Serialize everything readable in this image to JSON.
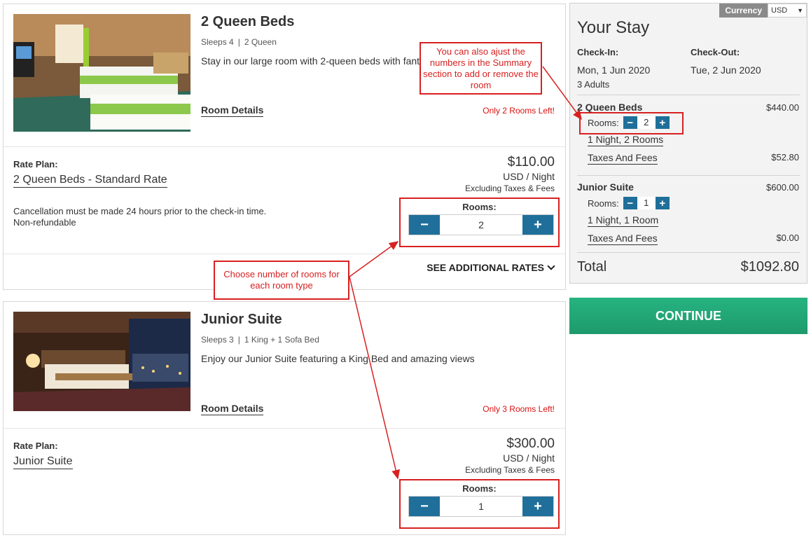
{
  "rooms": [
    {
      "title": "2 Queen Beds",
      "sleeps": "Sleeps 4",
      "beds": "2 Queen",
      "description": "Stay in our large room with 2-queen beds with fant",
      "details_link": "Room Details",
      "availability": "Only 2 Rooms Left!",
      "rate_label": "Rate Plan:",
      "rate_name": "2 Queen Beds - Standard Rate",
      "price": "$110.00",
      "price_unit": "USD / Night",
      "price_note": "Excluding Taxes & Fees",
      "cancellation_1": "Cancellation must be made 24 hours prior to the check-in time.",
      "cancellation_2": "Non-refundable",
      "rooms_label": "Rooms:",
      "rooms_count": "2",
      "see_more": "SEE ADDITIONAL RATES"
    },
    {
      "title": "Junior Suite",
      "sleeps": "Sleeps 3",
      "beds": "1 King + 1 Sofa Bed",
      "description": "Enjoy our Junior Suite featuring a King Bed and amazing views",
      "details_link": "Room Details",
      "availability": "Only 3 Rooms Left!",
      "rate_label": "Rate Plan:",
      "rate_name": "Junior Suite",
      "price": "$300.00",
      "price_unit": "USD / Night",
      "price_note": "Excluding Taxes & Fees",
      "rooms_label": "Rooms:",
      "rooms_count": "1"
    }
  ],
  "summary": {
    "currency_label": "Currency",
    "currency_value": "USD",
    "title": "Your Stay",
    "checkin_label": "Check-In:",
    "checkout_label": "Check-Out:",
    "checkin_date": "Mon, 1 Jun 2020",
    "checkout_date": "Tue, 2 Jun 2020",
    "guests": "3 Adults",
    "items": [
      {
        "name": "2 Queen Beds",
        "amount": "$440.00",
        "rooms_label": "Rooms:",
        "rooms_count": "2",
        "nights_link": "1 Night, 2 Rooms",
        "taxes_label": "Taxes And Fees",
        "taxes_amount": "$52.80"
      },
      {
        "name": "Junior Suite",
        "amount": "$600.00",
        "rooms_label": "Rooms:",
        "rooms_count": "1",
        "nights_link": "1 Night, 1 Room",
        "taxes_label": "Taxes And Fees",
        "taxes_amount": "$0.00"
      }
    ],
    "total_label": "Total",
    "total_value": "$1092.80"
  },
  "continue_label": "CONTINUE",
  "annotations": {
    "summary_note": "You can also ajust the numbers in the Summary section to add or remove the room",
    "rooms_note": "Choose number of rooms for each room type"
  },
  "colors": {
    "stepper_button": "#1f6f9a",
    "continue_button": "#1e9a6c",
    "annotation_red": "#d82020",
    "availability_red": "#dd1111"
  },
  "icons": {
    "minus": "−",
    "plus": "+",
    "dropdown": "▼"
  }
}
